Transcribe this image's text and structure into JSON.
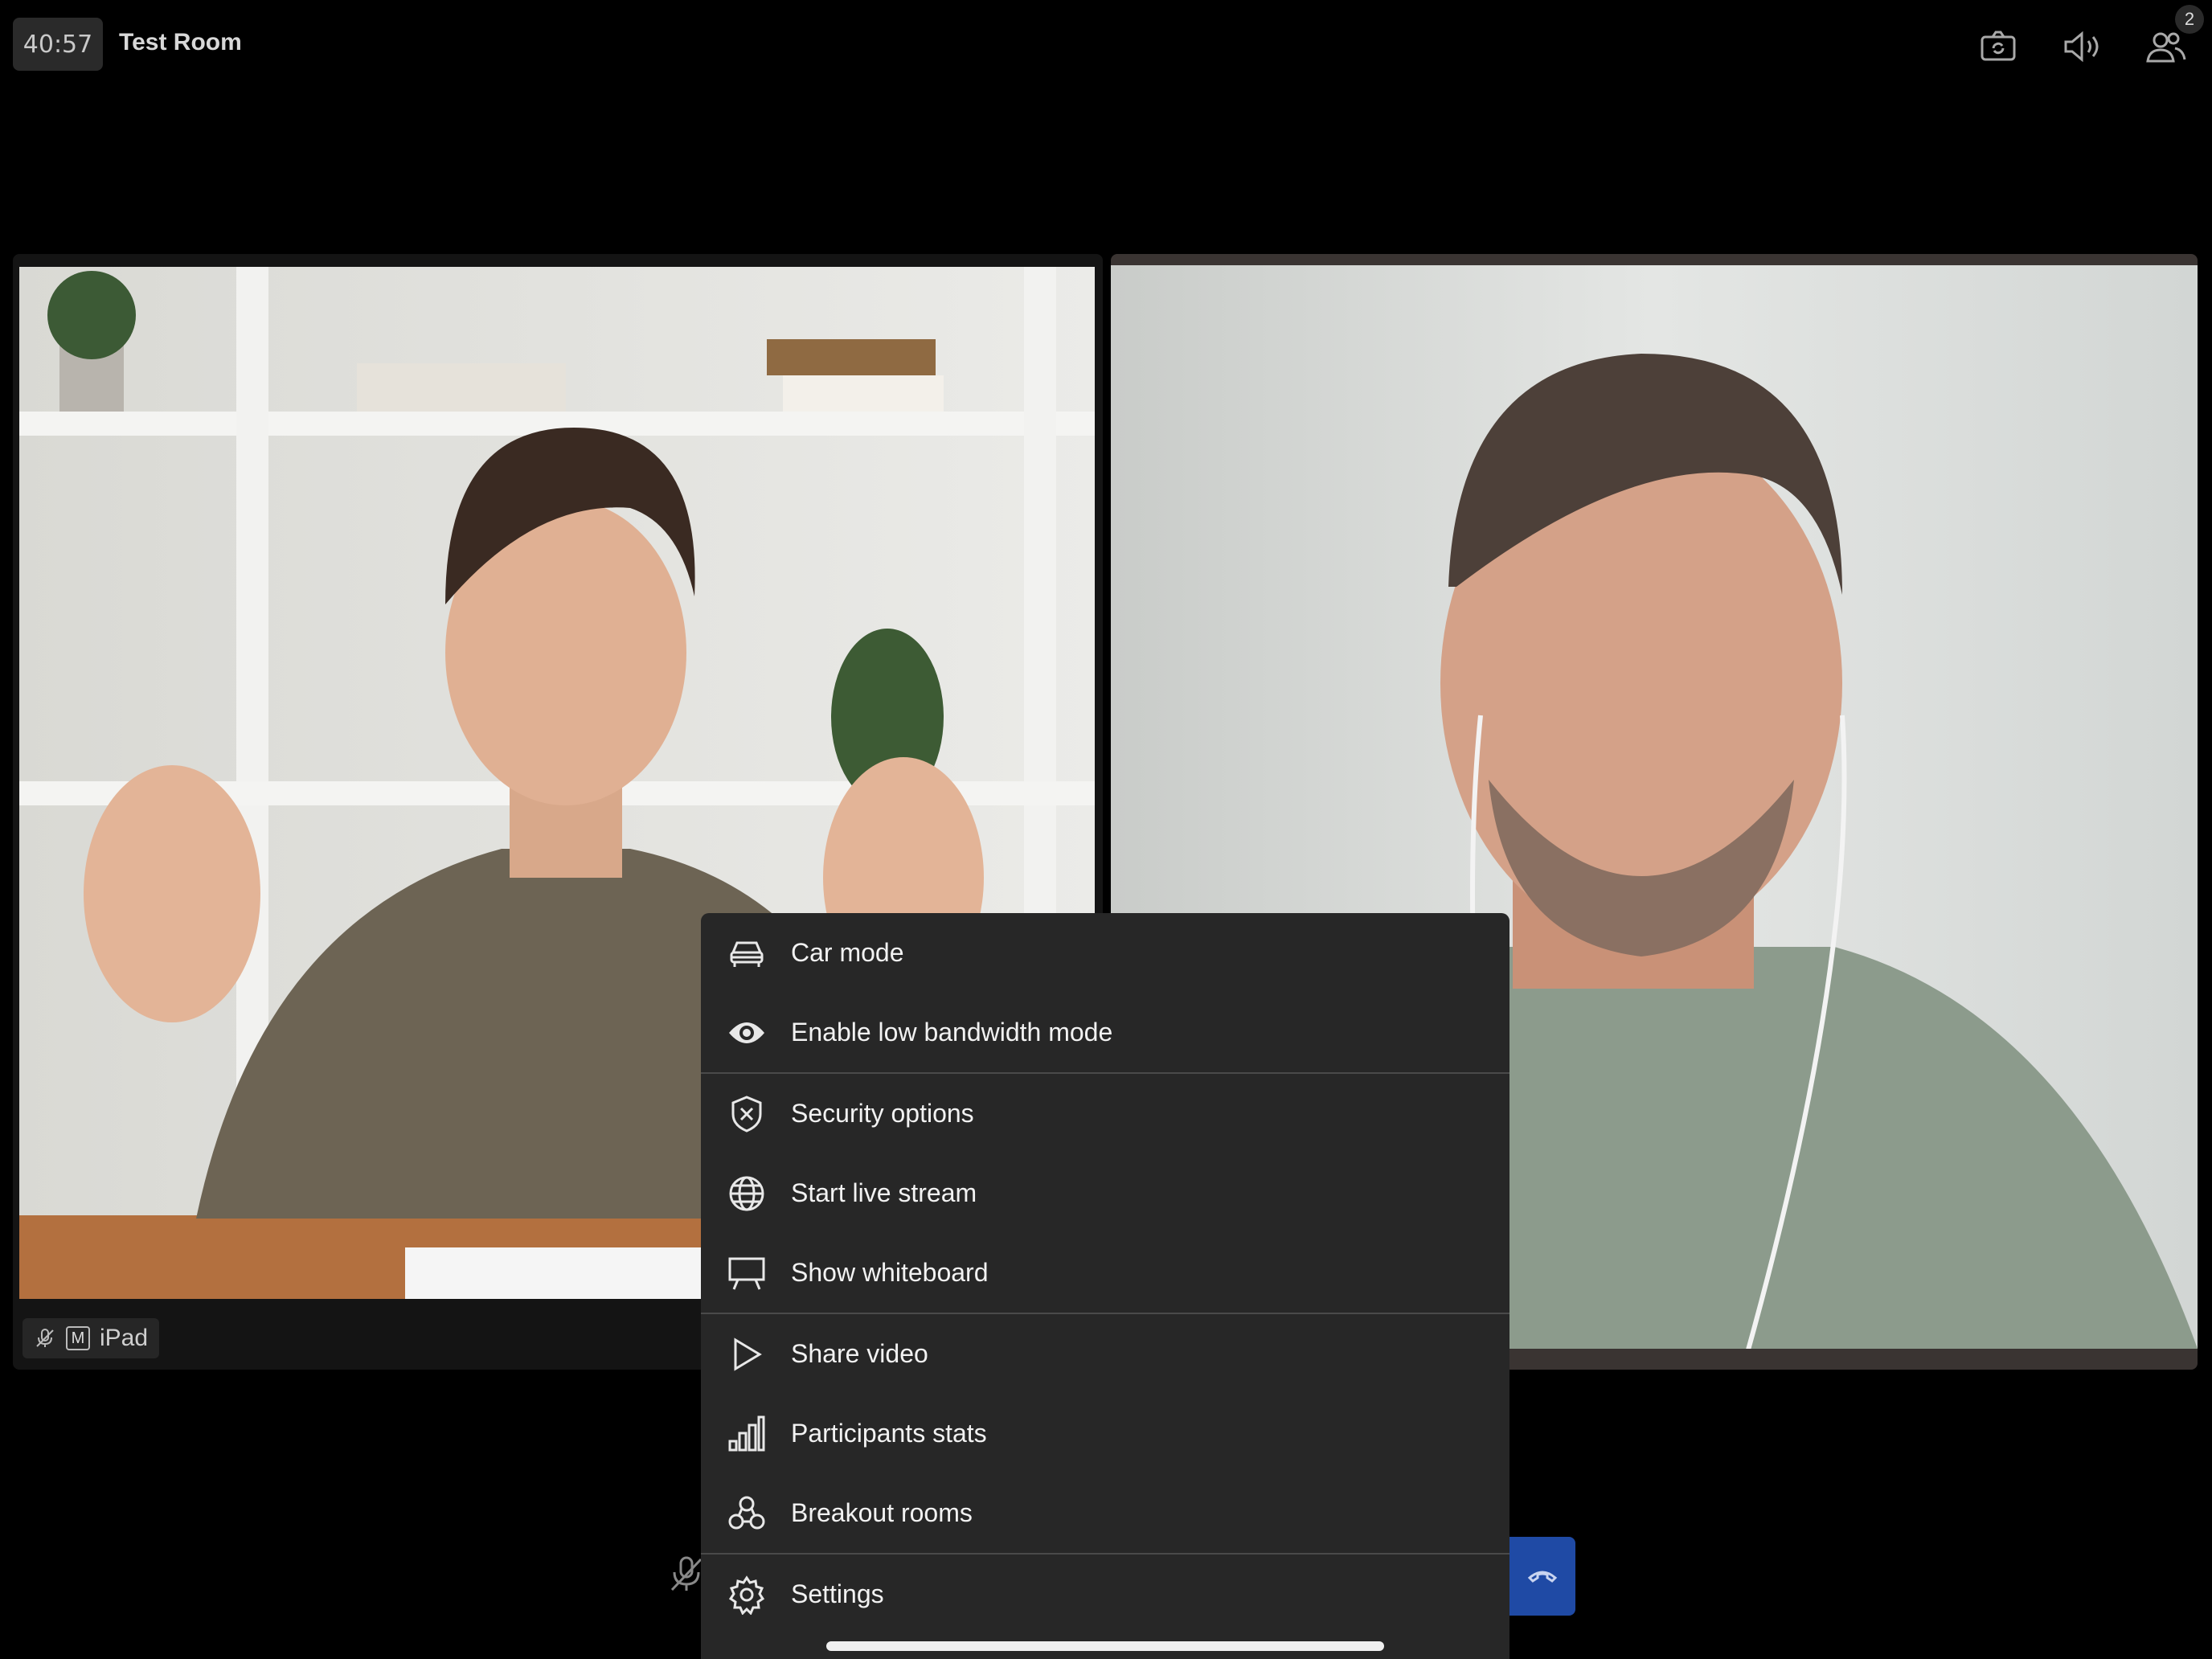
{
  "header": {
    "timer": "40:57",
    "room_name": "Test Room",
    "participant_count": "2",
    "icons": [
      "camera-switch-icon",
      "speaker-icon",
      "participants-icon"
    ]
  },
  "tiles": [
    {
      "participant_label": "iPad",
      "moderator_badge": "M",
      "muted": true
    },
    {
      "participant_label": "",
      "muted": false
    }
  ],
  "menu": {
    "items": [
      {
        "label": "Car mode",
        "icon": "car-icon"
      },
      {
        "label": "Enable low bandwidth mode",
        "icon": "eye-icon"
      },
      {
        "label": "Security options",
        "icon": "shield-icon"
      },
      {
        "label": "Start live stream",
        "icon": "globe-icon"
      },
      {
        "label": "Show whiteboard",
        "icon": "whiteboard-icon"
      },
      {
        "label": "Share video",
        "icon": "play-icon"
      },
      {
        "label": "Participants stats",
        "icon": "bar-chart-icon"
      },
      {
        "label": "Breakout rooms",
        "icon": "breakout-icon"
      },
      {
        "label": "Settings",
        "icon": "gear-icon"
      }
    ]
  },
  "colors": {
    "background": "#000000",
    "menu_bg": "#272727",
    "end_call": "#1f4aa5"
  }
}
